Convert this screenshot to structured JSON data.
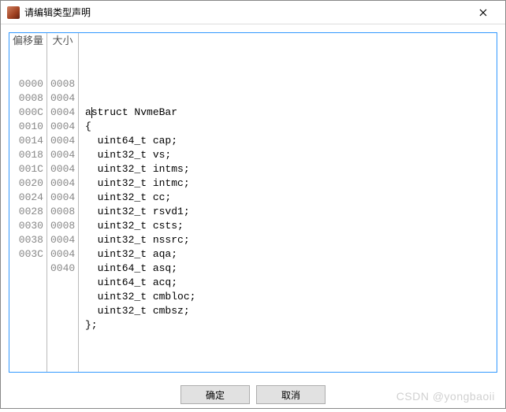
{
  "titlebar": {
    "title": "请编辑类型声明"
  },
  "columns": {
    "offset_header": "偏移量",
    "size_header": "大小"
  },
  "code": {
    "prefix_line": "a",
    "lines": [
      {
        "offset": "",
        "size": "",
        "text": "struct NvmeBar"
      },
      {
        "offset": "",
        "size": "",
        "text": "{"
      },
      {
        "offset": "0000",
        "size": "0008",
        "text": "  uint64_t cap;"
      },
      {
        "offset": "0008",
        "size": "0004",
        "text": "  uint32_t vs;"
      },
      {
        "offset": "000C",
        "size": "0004",
        "text": "  uint32_t intms;"
      },
      {
        "offset": "0010",
        "size": "0004",
        "text": "  uint32_t intmc;"
      },
      {
        "offset": "0014",
        "size": "0004",
        "text": "  uint32_t cc;"
      },
      {
        "offset": "0018",
        "size": "0004",
        "text": "  uint32_t rsvd1;"
      },
      {
        "offset": "001C",
        "size": "0004",
        "text": "  uint32_t csts;"
      },
      {
        "offset": "0020",
        "size": "0004",
        "text": "  uint32_t nssrc;"
      },
      {
        "offset": "0024",
        "size": "0004",
        "text": "  uint32_t aqa;"
      },
      {
        "offset": "0028",
        "size": "0008",
        "text": "  uint64_t asq;"
      },
      {
        "offset": "0030",
        "size": "0008",
        "text": "  uint64_t acq;"
      },
      {
        "offset": "0038",
        "size": "0004",
        "text": "  uint32_t cmbloc;"
      },
      {
        "offset": "003C",
        "size": "0004",
        "text": "  uint32_t cmbsz;"
      },
      {
        "offset": "",
        "size": "0040",
        "text": "};"
      }
    ]
  },
  "buttons": {
    "ok": "确定",
    "cancel": "取消"
  },
  "watermark": "CSDN @yongbaoii"
}
